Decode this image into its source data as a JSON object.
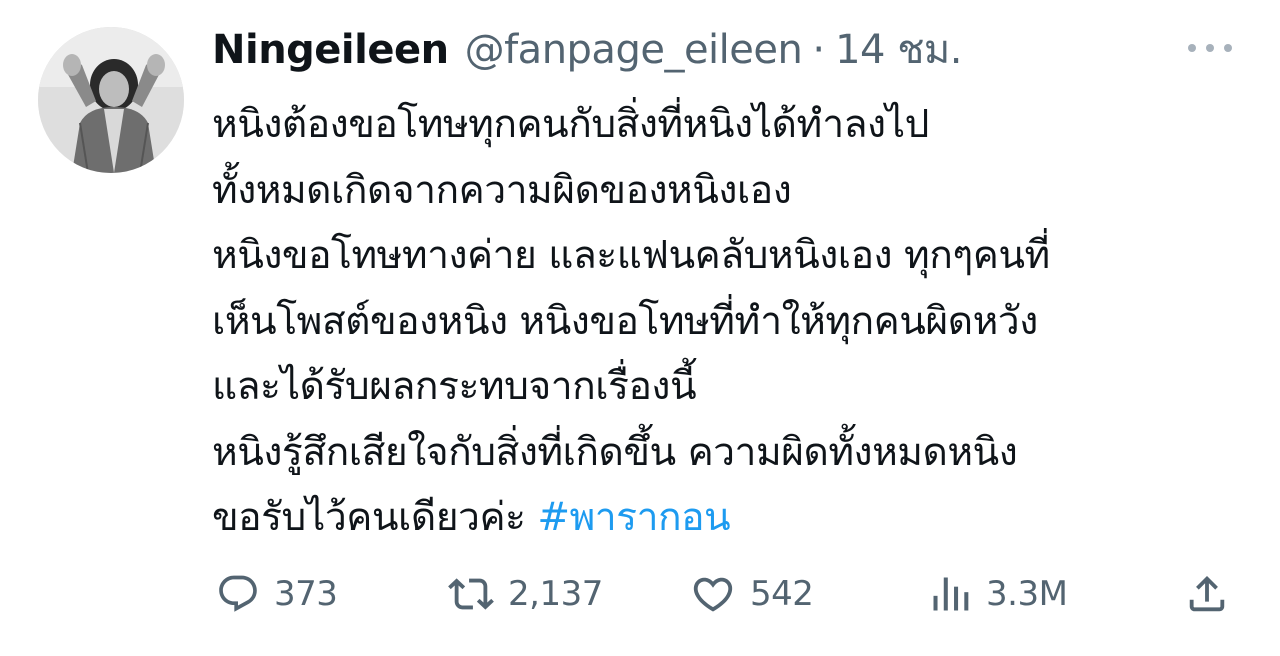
{
  "tweet": {
    "display_name": "Ningeileen",
    "handle": "@fanpage_eileen",
    "separator": "·",
    "time": "14 ชม.",
    "more_icon": "more-dots-icon",
    "text_lines": [
      "หนิงต้องขอโทษทุกคนกับสิ่งที่หนิงได้ทำลงไป",
      "ทั้งหมดเกิดจากความผิดของหนิงเอง",
      "หนิงขอโทษทางค่าย และแฟนคลับหนิงเอง ทุกๆคนที่",
      "เห็นโพสต์ของหนิง หนิงขอโทษที่ทำให้ทุกคนผิดหวัง",
      "และได้รับผลกระทบจากเรื่องนี้",
      "หนิงรู้สึกเสียใจกับสิ่งที่เกิดขึ้น ความผิดทั้งหมดหนิง"
    ],
    "last_line_text": "ขอรับไว้คนเดียวค่ะ ",
    "hashtag": "#พารากอน",
    "hashtag_color": "#1d9bf0",
    "text_color": "#0f1419",
    "secondary_color": "#536471"
  },
  "actions": {
    "reply": {
      "icon": "reply-icon",
      "count": "373"
    },
    "retweet": {
      "icon": "retweet-icon",
      "count": "2,137"
    },
    "like": {
      "icon": "like-heart-icon",
      "count": "542"
    },
    "views": {
      "icon": "views-chart-icon",
      "count": "3.3M"
    },
    "share": {
      "icon": "share-icon"
    }
  }
}
